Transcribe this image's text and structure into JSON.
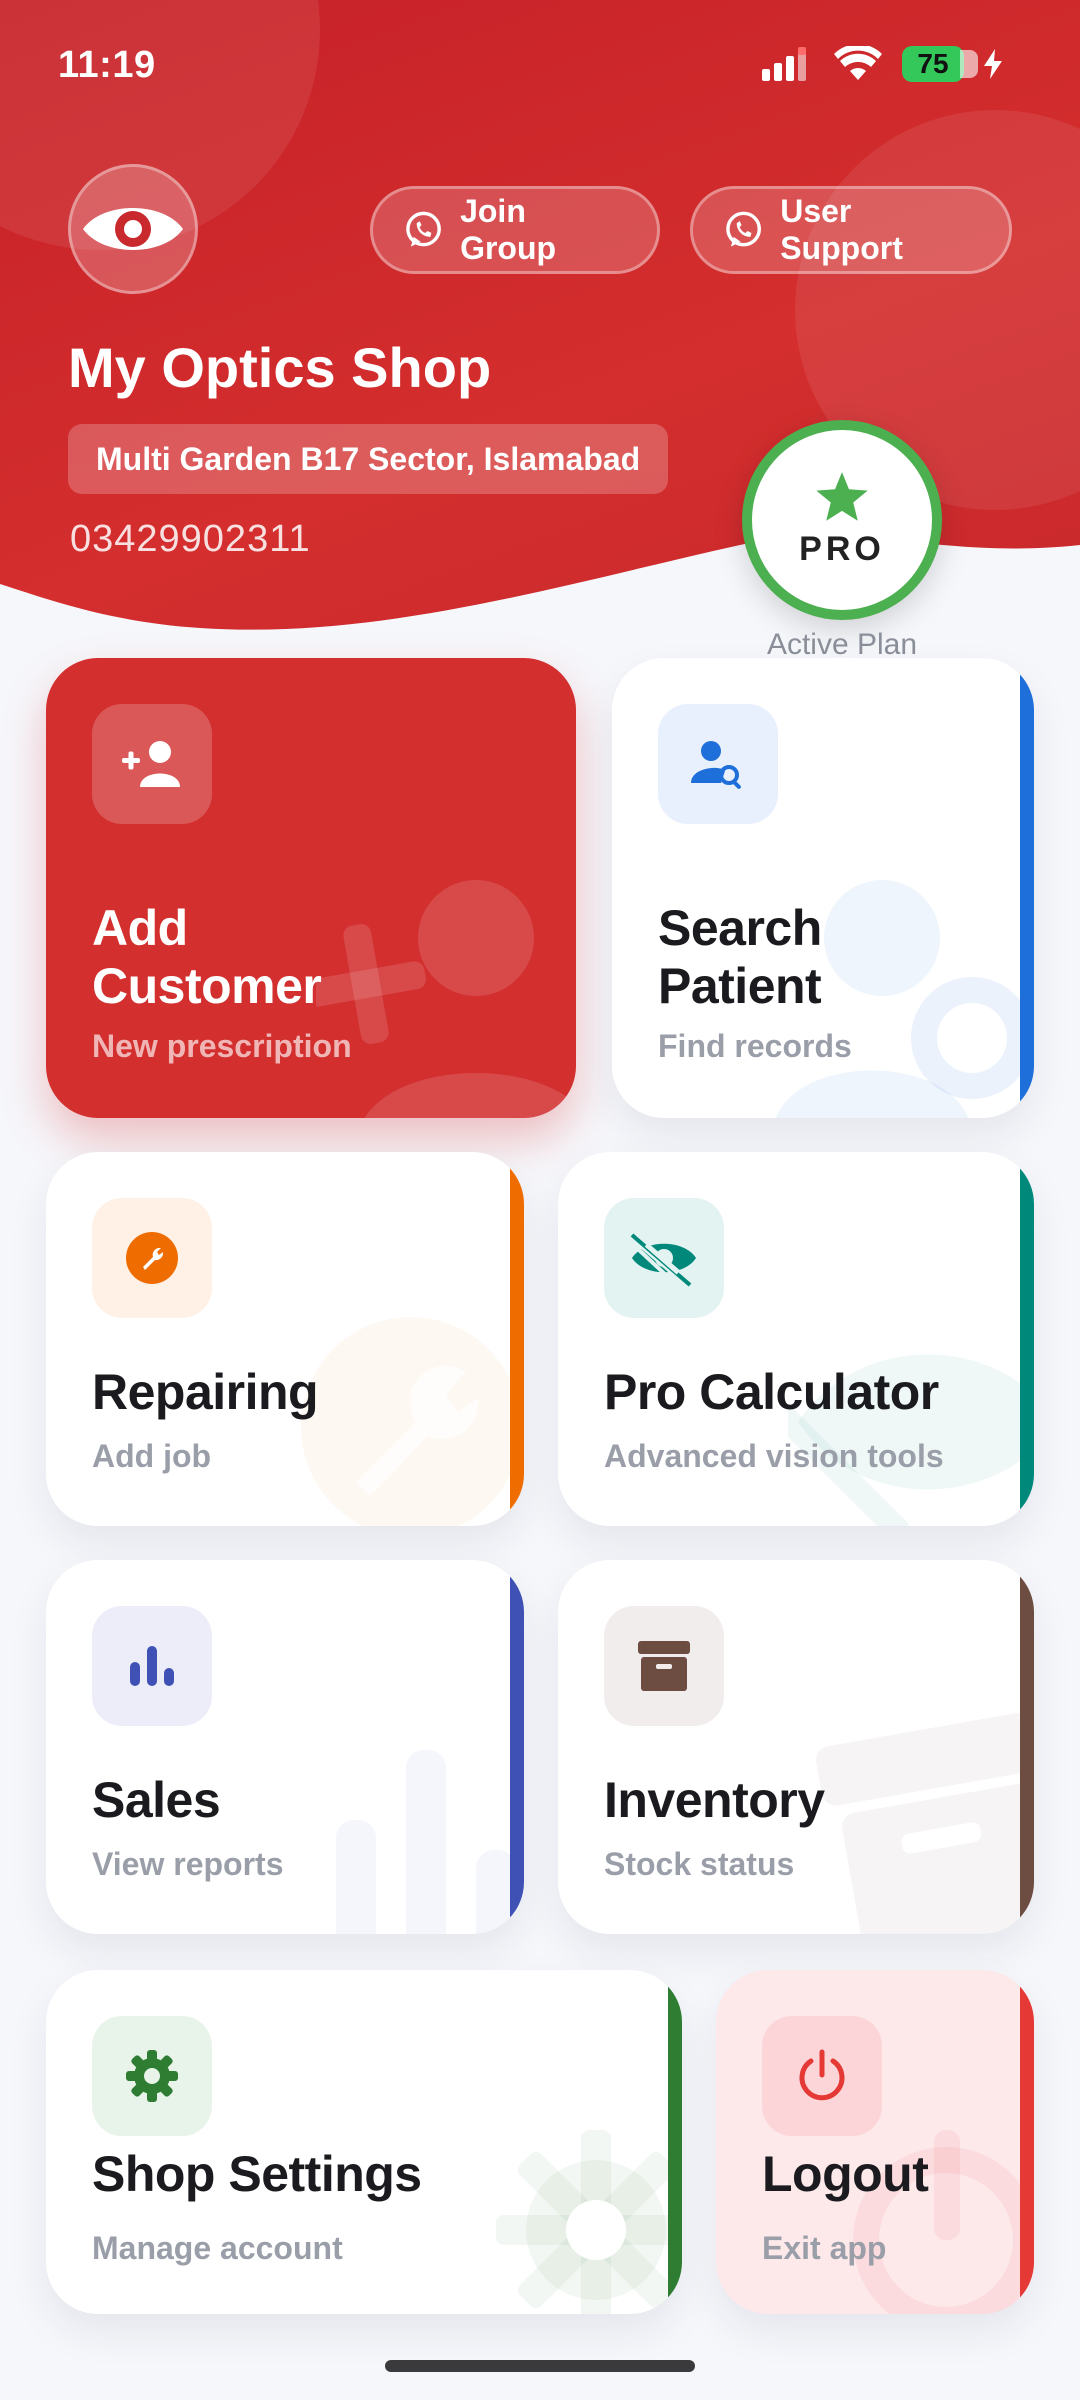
{
  "status_bar": {
    "time": "11:19",
    "battery": "75"
  },
  "header": {
    "join_group_label": "Join Group",
    "user_support_label": "User Support",
    "shop_name": "My Optics Shop",
    "address": "Multi Garden B17 Sector, Islamabad",
    "phone": "03429902311",
    "plan_badge": "PRO",
    "plan_caption": "Active Plan"
  },
  "cards": {
    "add_customer": {
      "title_line1": "Add",
      "title_line2": "Customer",
      "subtitle": "New prescription",
      "icon": "person-add-icon"
    },
    "search_patient": {
      "title_line1": "Search",
      "title_line2": "Patient",
      "subtitle": "Find records",
      "icon": "person-search-icon",
      "accent": "#1e6fd9"
    },
    "repairing": {
      "title": "Repairing",
      "subtitle": "Add job",
      "icon": "wrench-icon",
      "accent": "#ef6c00"
    },
    "pro_calculator": {
      "title": "Pro Calculator",
      "subtitle": "Advanced vision tools",
      "icon": "eye-slash-icon",
      "accent": "#00897b"
    },
    "sales": {
      "title": "Sales",
      "subtitle": "View reports",
      "icon": "bar-chart-icon",
      "accent": "#3f51b5"
    },
    "inventory": {
      "title": "Inventory",
      "subtitle": "Stock status",
      "icon": "archive-box-icon",
      "accent": "#6d4c41"
    },
    "shop_settings": {
      "title": "Shop Settings",
      "subtitle": "Manage account",
      "icon": "gear-icon",
      "accent": "#2e7d32"
    },
    "logout": {
      "title": "Logout",
      "subtitle": "Exit app",
      "icon": "power-icon",
      "accent": "#e53935"
    }
  },
  "colors": {
    "brand_red": "#d32f2f",
    "pro_green": "#4caf50"
  }
}
